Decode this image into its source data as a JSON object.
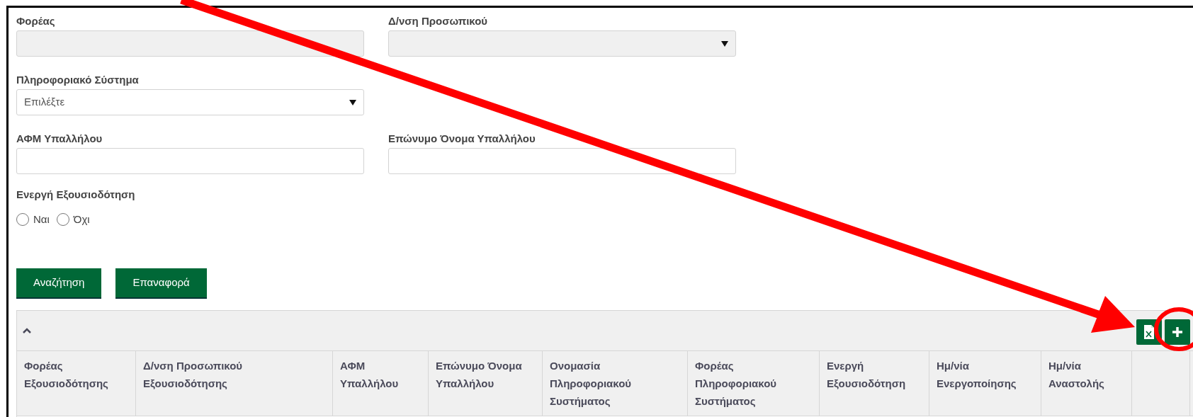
{
  "form_rows": [
    [
      {
        "label": "Φορέας",
        "kind": "text",
        "disabled": true
      },
      {
        "label": "Δ/νση Προσωπικού",
        "kind": "select",
        "disabled": true
      }
    ],
    [
      {
        "label": "Πληροφοριακό Σύστημα",
        "kind": "select",
        "disabled": false,
        "value": "Επιλέξτε"
      }
    ],
    [
      {
        "label": "ΑΦΜ Υπαλλήλου",
        "kind": "text",
        "disabled": false
      },
      {
        "label": "Επώνυμο Όνομα Υπαλλήλου",
        "kind": "text",
        "disabled": false
      }
    ]
  ],
  "radio_group": {
    "label": "Ενεργή Εξουσιοδότηση",
    "options": [
      {
        "label": "Ναι",
        "checked": false
      },
      {
        "label": "Όχι",
        "checked": false
      }
    ]
  },
  "buttons": [
    "Αναζήτηση",
    "Επαναφορά"
  ],
  "table": {
    "columns": [
      "Φορέας\nΕξουσιοδότησης",
      "Δ/νση Προσωπικού\nΕξουσιοδότησης",
      "ΑΦΜ\nΥπαλλήλου",
      "Επώνυμο Όνομα\nΥπαλλήλου",
      "Ονομασία\nΠληροφοριακού\nΣυστήματος",
      "Φορέας\nΠληροφοριακού\nΣυστήματος",
      "Ενεργή\nΕξουσιοδότηση",
      "Ημ/νία\nΕνεργοποίησης",
      "Ημ/νία\nΑναστολής",
      ""
    ]
  }
}
